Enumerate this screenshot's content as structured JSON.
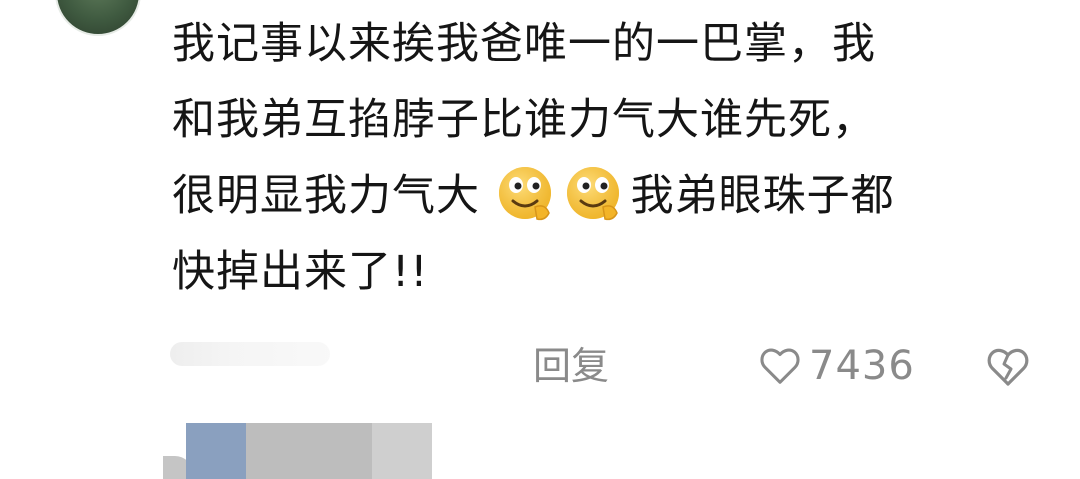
{
  "comment": {
    "lines": [
      "我记事以来挨我爸唯一的一巴掌，我",
      "和我弟互掐脖子比谁力气大谁先死，",
      "很明显我力气大",
      "我弟眼珠子都",
      "快掉出来了!!"
    ],
    "emojis": [
      "smirk-emoji",
      "smirk-emoji"
    ]
  },
  "actions": {
    "reply_label": "回复",
    "like_count": "7436",
    "like_icon": "heart-outline-icon",
    "dislike_icon": "broken-heart-icon"
  },
  "colors": {
    "text": "#151515",
    "meta": "#8a8a8a",
    "emoji_face": "#f7c53a"
  }
}
